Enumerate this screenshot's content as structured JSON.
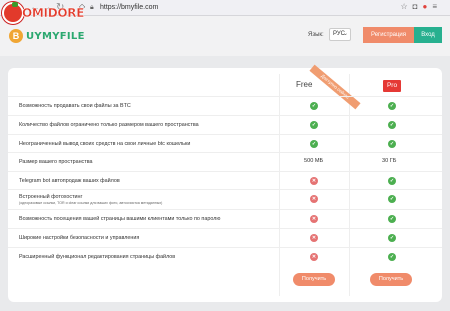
{
  "browser": {
    "url": "https://bmyfile.com",
    "pomidore": "OMIDORE"
  },
  "header": {
    "logo_text": "UYMYFILE",
    "logo_letter": "B",
    "lang_label": "Язык:",
    "lang_value": "РУС",
    "register_label": "Регистрация",
    "login_label": "Вход"
  },
  "plans": {
    "free_label": "Free",
    "pro_label": "Pro",
    "ribbon_label": "Доступно сейчас",
    "get_label": "Получить"
  },
  "features": [
    {
      "label": "Возможность продавать свои файлы за BTC",
      "free": "check",
      "pro": "check"
    },
    {
      "label": "Количество файлов ограничено только размером вашего пространства",
      "free": "check",
      "pro": "check"
    },
    {
      "label": "Неограниченный вывод своих средств на свои личные btc кошельки",
      "free": "check",
      "pro": "check"
    },
    {
      "label": "Размер вашего пространства",
      "free_text": "500 МБ",
      "pro_text": "30 ГБ"
    },
    {
      "label": "Telegram bot автопродаж ваших файлов",
      "free": "cross",
      "pro": "check"
    },
    {
      "label": "Встроенный фотохостинг",
      "sub": "(одноразовые ссылки, TOR и clear ссылки для ваших фото, автоочистка метаданных)",
      "free": "cross",
      "pro": "check"
    },
    {
      "label": "Возможность посещения вашей страницы вашими клиентами только по паролю",
      "free": "cross",
      "pro": "check"
    },
    {
      "label": "Широкие настройки безопасности и управления",
      "free": "cross",
      "pro": "check"
    },
    {
      "label": "Расширенный функционал редактирования страницы файлов",
      "free": "cross",
      "pro": "check"
    }
  ],
  "colors": {
    "accent_orange": "#f08b6a",
    "accent_green": "#27b08f",
    "check": "#4caf50",
    "cross": "#e57373"
  }
}
